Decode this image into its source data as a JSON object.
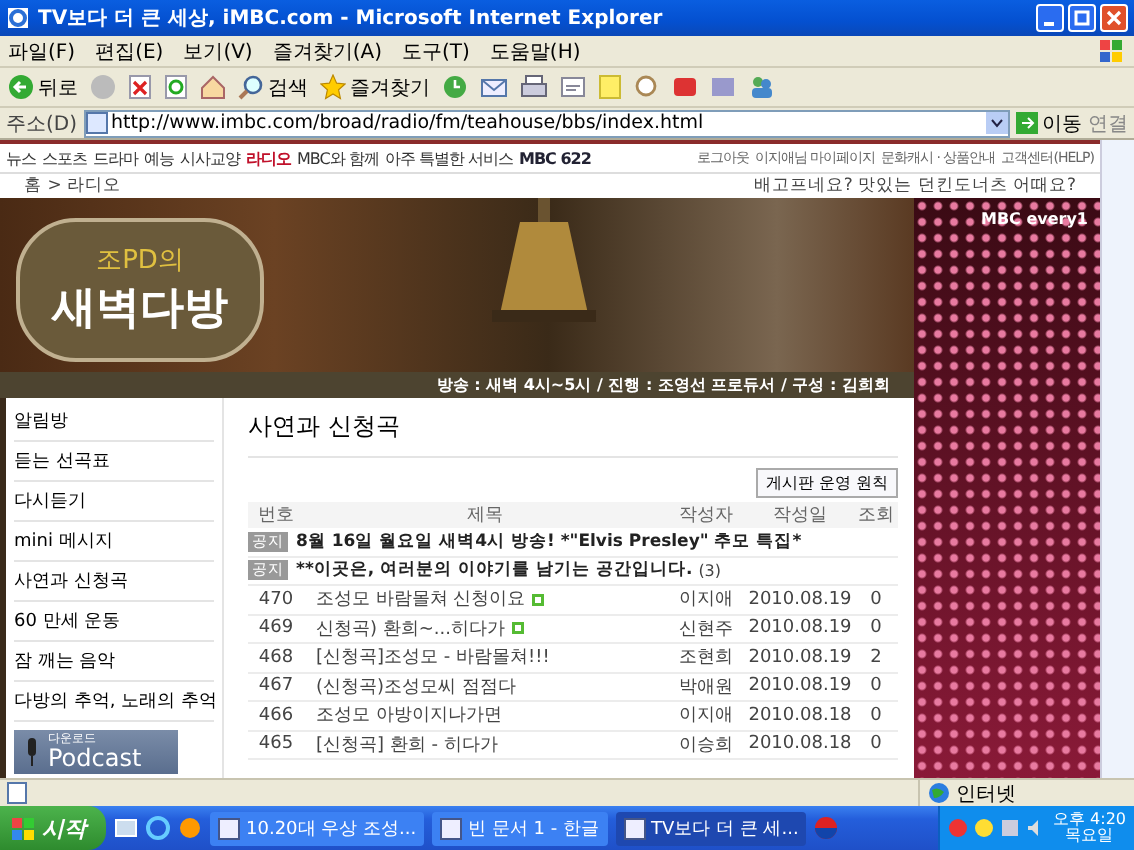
{
  "window": {
    "title": "TV보다 더 큰 세상, iMBC.com - Microsoft Internet Explorer"
  },
  "menu": [
    "파일(F)",
    "편집(E)",
    "보기(V)",
    "즐겨찾기(A)",
    "도구(T)",
    "도움말(H)"
  ],
  "toolbar": {
    "back": "뒤로",
    "search": "검색",
    "favorites": "즐겨찾기"
  },
  "address_bar": {
    "label": "주소(D)",
    "value": "http://www.imbc.com/broad/radio/fm/teahouse/bbs/index.html",
    "go": "이동",
    "links": "연결"
  },
  "site_nav": {
    "items": [
      {
        "label": "뉴스",
        "selected": false
      },
      {
        "label": "스포츠",
        "selected": false
      },
      {
        "label": "드라마",
        "selected": false
      },
      {
        "label": "예능",
        "selected": false
      },
      {
        "label": "시사교양",
        "selected": false
      },
      {
        "label": "라디오",
        "selected": true
      },
      {
        "label": "MBC와 함께",
        "selected": false
      },
      {
        "label": "아주 특별한 서비스",
        "selected": false
      }
    ],
    "logo": "MBC 622",
    "user_links": [
      "로그아웃",
      "이지애님 마이페이지",
      "문화캐시 · 상품안내",
      "고객센터(HELP)"
    ]
  },
  "breadcrumb": "홈 > 라디오",
  "promo_text": "배고프네요? 맛있는 던킨도너츠 어때요?",
  "header": {
    "logo_top": "조PD의",
    "logo_main": "새벽다방",
    "info": "방송 : 새벽 4시~5시  /  진행 : 조영선 프로듀서  /  구성 : 김희회",
    "channel_logo": "MBC every1"
  },
  "sidebar": {
    "items": [
      "알림방",
      "듣는 선곡표",
      "다시듣기",
      "mini 메시지",
      "사연과 신청곡",
      "60 만세 운동",
      "잠 깨는 음악",
      "다방의 추억, 노래의 추억"
    ],
    "podcast": {
      "small": "다운로드",
      "label": "Podcast"
    }
  },
  "board": {
    "title": "사연과 신청곡",
    "rules_button": "게시판 운영 원칙",
    "columns": [
      "번호",
      "제목",
      "작성자",
      "작성일",
      "조회"
    ],
    "rows": [
      {
        "kind": "notice",
        "badge": "공지",
        "title": "8월 16일 월요일 새벽4시 방송! *\"Elvis Presley\" 추모 특집*"
      },
      {
        "kind": "notice",
        "badge": "공지",
        "title": "**이곳은, 여러분의 이야기를 남기는 공간입니다.",
        "comments": "(3)"
      },
      {
        "kind": "post",
        "number": "470",
        "title": "조성모 바람몰쳐 신청이요",
        "new": true,
        "author": "이지애",
        "date": "2010.08.19",
        "views": "0"
      },
      {
        "kind": "post",
        "number": "469",
        "title": "신청곡) 환희~...히다가",
        "new": true,
        "author": "신현주",
        "date": "2010.08.19",
        "views": "0"
      },
      {
        "kind": "post",
        "number": "468",
        "title": "[신청곡]조성모 - 바람몰쳐!!!",
        "new": false,
        "author": "조현희",
        "date": "2010.08.19",
        "views": "2"
      },
      {
        "kind": "post",
        "number": "467",
        "title": "(신청곡)조성모씨 점점다",
        "new": false,
        "author": "박애원",
        "date": "2010.08.19",
        "views": "0"
      },
      {
        "kind": "post",
        "number": "466",
        "title": "조성모 아방이지나가면",
        "new": false,
        "author": "이지애",
        "date": "2010.08.18",
        "views": "0"
      },
      {
        "kind": "post",
        "number": "465",
        "title": "[신청곡] 환희 - 히다가",
        "new": false,
        "author": "이승희",
        "date": "2010.08.18",
        "views": "0"
      }
    ]
  },
  "status_bar": {
    "zone": "인터넷"
  },
  "taskbar": {
    "start": "시작",
    "items": [
      {
        "label": "10.20대 우상 조성...",
        "selected": false
      },
      {
        "label": "빈 문서 1 - 한글",
        "selected": false
      },
      {
        "label": "TV보다 더 큰 세...",
        "selected": true
      }
    ],
    "time": "오후 4:20",
    "day": "목요일"
  }
}
